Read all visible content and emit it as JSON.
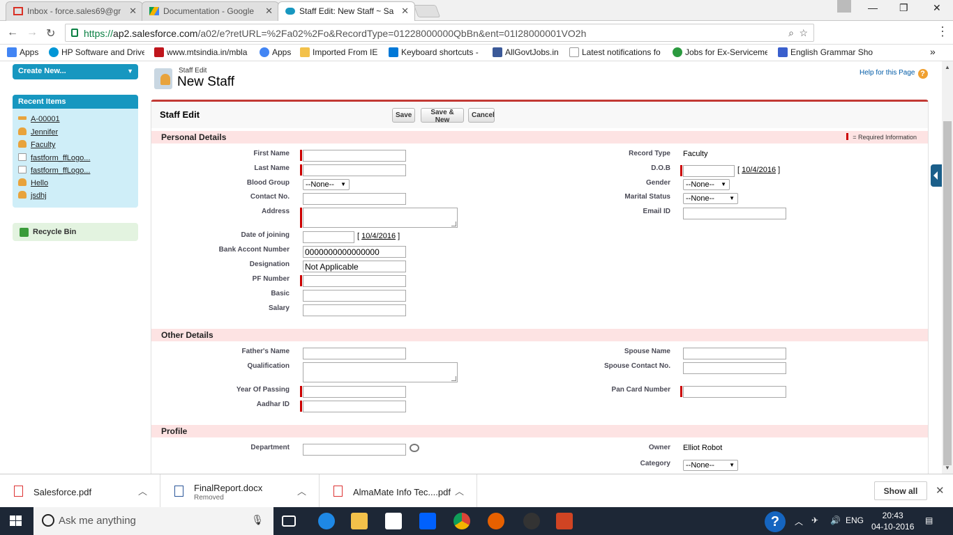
{
  "browser": {
    "tabs": [
      {
        "label": "Inbox - force.sales69@gr",
        "color": "#d93025"
      },
      {
        "label": "Documentation - Google",
        "color": "#1a73e8"
      },
      {
        "label": "Staff Edit: New Staff ~ Sa",
        "color": "#1797c0"
      }
    ],
    "url_https": "https://",
    "url_host": "ap2.salesforce.com",
    "url_path": "/a02/e?retURL=%2Fa02%2Fo&RecordType=01228000000QbBn&ent=01I28000001VO2h",
    "bookmarks": [
      {
        "label": "Apps",
        "icon": "apps-grid-icon",
        "color": "#4285f4"
      },
      {
        "label": "HP Software and Drive",
        "icon": "hp-icon",
        "color": "#0096d6"
      },
      {
        "label": "www.mtsindia.in/mbla",
        "icon": "mts-icon",
        "color": "#c0161d"
      },
      {
        "label": "Apps",
        "icon": "google-icon",
        "color": "#4285f4"
      },
      {
        "label": "Imported From IE",
        "icon": "folder-icon",
        "color": "#f3c14a"
      },
      {
        "label": "Keyboard shortcuts -",
        "icon": "windows-icon",
        "color": "#0078d7"
      },
      {
        "label": "AllGovtJobs.in",
        "icon": "facebook-icon",
        "color": "#3b5998"
      },
      {
        "label": "Latest notifications fo",
        "icon": "page-icon",
        "color": "#999999"
      },
      {
        "label": "Jobs for Ex-Serviceme",
        "icon": "q-icon",
        "color": "#2b9a3f"
      },
      {
        "label": "English Grammar Sho",
        "icon": "grammar-icon",
        "color": "#3a5fcd"
      }
    ]
  },
  "sidebar": {
    "create_new": "Create New...",
    "recent_header": "Recent Items",
    "recent_items": [
      {
        "label": "A-00001",
        "icon": "key-icon"
      },
      {
        "label": "Jennifer",
        "icon": "person-icon"
      },
      {
        "label": "Faculty",
        "icon": "person-icon"
      },
      {
        "label": "fastform_ffLogo...",
        "icon": "document-icon"
      },
      {
        "label": "fastform_ffLogo...",
        "icon": "document-icon"
      },
      {
        "label": "Hello",
        "icon": "person-icon"
      },
      {
        "label": "jsdhj",
        "icon": "person-icon"
      }
    ],
    "recycle_bin": "Recycle Bin"
  },
  "page": {
    "subtitle": "Staff Edit",
    "title": "New Staff",
    "help": "Help for this Page",
    "block_title": "Staff Edit",
    "buttons": {
      "save": "Save",
      "save_new": "Save & New",
      "cancel": "Cancel"
    },
    "required_info": "= Required Information"
  },
  "personal": {
    "header": "Personal Details",
    "first_name": {
      "label": "First Name",
      "value": ""
    },
    "last_name": {
      "label": "Last Name",
      "value": ""
    },
    "blood_group": {
      "label": "Blood Group",
      "value": "--None--"
    },
    "contact_no": {
      "label": "Contact No.",
      "value": ""
    },
    "address": {
      "label": "Address",
      "value": ""
    },
    "date_of_joining": {
      "label": "Date of joining",
      "value": "",
      "today": "10/4/2016"
    },
    "bank_account": {
      "label": "Bank Accont Number",
      "value": "0000000000000000"
    },
    "designation": {
      "label": "Designation",
      "value": "Not Applicable"
    },
    "pf_number": {
      "label": "PF Number",
      "value": ""
    },
    "basic": {
      "label": "Basic",
      "value": ""
    },
    "salary": {
      "label": "Salary",
      "value": ""
    },
    "record_type": {
      "label": "Record Type",
      "value": "Faculty"
    },
    "dob": {
      "label": "D.O.B",
      "value": "",
      "today": "10/4/2016"
    },
    "gender": {
      "label": "Gender",
      "value": "--None--"
    },
    "marital_status": {
      "label": "Marital Status",
      "value": "--None--"
    },
    "email": {
      "label": "Email ID",
      "value": ""
    }
  },
  "other": {
    "header": "Other Details",
    "fathers_name": {
      "label": "Father's Name",
      "value": ""
    },
    "qualification": {
      "label": "Qualification",
      "value": ""
    },
    "year_of_passing": {
      "label": "Year Of Passing",
      "value": ""
    },
    "aadhar": {
      "label": "Aadhar ID",
      "value": ""
    },
    "spouse_name": {
      "label": "Spouse Name",
      "value": ""
    },
    "spouse_contact": {
      "label": "Spouse Contact No.",
      "value": ""
    },
    "pan": {
      "label": "Pan Card Number",
      "value": ""
    }
  },
  "profile": {
    "header": "Profile",
    "department": {
      "label": "Department",
      "value": ""
    },
    "owner": {
      "label": "Owner",
      "value": "Elliot Robot"
    },
    "category": {
      "label": "Category",
      "value": "--None--"
    }
  },
  "downloads": {
    "items": [
      {
        "name": "Salesforce.pdf",
        "status": ""
      },
      {
        "name": "FinalReport.docx",
        "status": "Removed"
      },
      {
        "name": "AlmaMate Info Tec....pdf",
        "status": ""
      }
    ],
    "show_all": "Show all"
  },
  "taskbar": {
    "search_placeholder": "Ask me anything",
    "lang": "ENG",
    "time": "20:43",
    "date": "04-10-2016"
  },
  "colors": {
    "accent": "#1797c0",
    "required": "#cc0000",
    "section_bg": "#fde3e3",
    "block_top": "#c23934"
  }
}
